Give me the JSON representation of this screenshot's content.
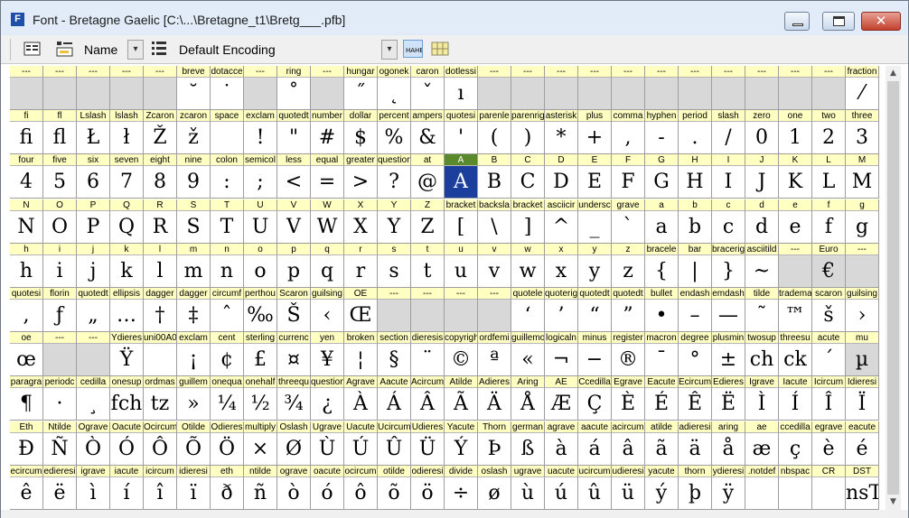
{
  "window": {
    "title": "Font - Bretagne Gaelic [C:\\...\\Bretagne_t1\\Bretg___.pfb]",
    "app_icon": "F"
  },
  "toolbar": {
    "name_label": "Name",
    "encoding_label": "Default Encoding"
  },
  "rows": [
    [
      [
        "---",
        ""
      ],
      [
        "---",
        ""
      ],
      [
        "---",
        ""
      ],
      [
        "---",
        ""
      ],
      [
        "---",
        ""
      ],
      [
        "breve",
        "˘"
      ],
      [
        "dotacce",
        "˙"
      ],
      [
        "---",
        ""
      ],
      [
        "ring",
        "˚"
      ],
      [
        "---",
        ""
      ],
      [
        "hungar",
        "˝"
      ],
      [
        "ogonek",
        "˛"
      ],
      [
        "caron",
        "ˇ"
      ],
      [
        "dotlessi",
        "ı"
      ],
      [
        "---",
        ""
      ],
      [
        "---",
        ""
      ],
      [
        "---",
        ""
      ],
      [
        "---",
        ""
      ],
      [
        "---",
        ""
      ],
      [
        "---",
        ""
      ],
      [
        "---",
        ""
      ],
      [
        "---",
        ""
      ],
      [
        "---",
        ""
      ],
      [
        "---",
        ""
      ],
      [
        "---",
        ""
      ],
      [
        "fraction",
        "⁄"
      ]
    ],
    [
      [
        "fi",
        "ﬁ"
      ],
      [
        "fl",
        "ﬂ"
      ],
      [
        "Lslash",
        "Ł"
      ],
      [
        "lslash",
        "ł"
      ],
      [
        "Zcaron",
        "Ž"
      ],
      [
        "zcaron",
        "ž"
      ],
      [
        "space",
        ""
      ],
      [
        "exclam",
        "!"
      ],
      [
        "quotedt",
        "\""
      ],
      [
        "number",
        "#"
      ],
      [
        "dollar",
        "$"
      ],
      [
        "percent",
        "%"
      ],
      [
        "ampers",
        "&"
      ],
      [
        "quotesi",
        "'"
      ],
      [
        "parenle",
        "("
      ],
      [
        "parenrig",
        ")"
      ],
      [
        "asterisk",
        "*"
      ],
      [
        "plus",
        "+"
      ],
      [
        "comma",
        ","
      ],
      [
        "hyphen",
        "-"
      ],
      [
        "period",
        "."
      ],
      [
        "slash",
        "/"
      ],
      [
        "zero",
        "0"
      ],
      [
        "one",
        "1"
      ],
      [
        "two",
        "2"
      ],
      [
        "three",
        "3"
      ]
    ],
    [
      [
        "four",
        "4"
      ],
      [
        "five",
        "5"
      ],
      [
        "six",
        "6"
      ],
      [
        "seven",
        "7"
      ],
      [
        "eight",
        "8"
      ],
      [
        "nine",
        "9"
      ],
      [
        "colon",
        ":"
      ],
      [
        "semicol",
        ";"
      ],
      [
        "less",
        "<"
      ],
      [
        "equal",
        "="
      ],
      [
        "greater",
        ">"
      ],
      [
        "question",
        "?"
      ],
      [
        "at",
        "@"
      ],
      [
        "A",
        "A"
      ],
      [
        "B",
        "B"
      ],
      [
        "C",
        "C"
      ],
      [
        "D",
        "D"
      ],
      [
        "E",
        "E"
      ],
      [
        "F",
        "F"
      ],
      [
        "G",
        "G"
      ],
      [
        "H",
        "H"
      ],
      [
        "I",
        "I"
      ],
      [
        "J",
        "J"
      ],
      [
        "K",
        "K"
      ],
      [
        "L",
        "L"
      ],
      [
        "M",
        "M"
      ]
    ],
    [
      [
        "N",
        "N"
      ],
      [
        "O",
        "O"
      ],
      [
        "P",
        "P"
      ],
      [
        "Q",
        "Q"
      ],
      [
        "R",
        "R"
      ],
      [
        "S",
        "S"
      ],
      [
        "T",
        "T"
      ],
      [
        "U",
        "U"
      ],
      [
        "V",
        "V"
      ],
      [
        "W",
        "W"
      ],
      [
        "X",
        "X"
      ],
      [
        "Y",
        "Y"
      ],
      [
        "Z",
        "Z"
      ],
      [
        "bracket",
        "["
      ],
      [
        "backsla",
        "\\"
      ],
      [
        "bracket",
        "]"
      ],
      [
        "asciicir",
        "^"
      ],
      [
        "undersc",
        "_"
      ],
      [
        "grave",
        "`"
      ],
      [
        "a",
        "a"
      ],
      [
        "b",
        "b"
      ],
      [
        "c",
        "c"
      ],
      [
        "d",
        "d"
      ],
      [
        "e",
        "e"
      ],
      [
        "f",
        "f"
      ],
      [
        "g",
        "g"
      ]
    ],
    [
      [
        "h",
        "h"
      ],
      [
        "i",
        "i"
      ],
      [
        "j",
        "j"
      ],
      [
        "k",
        "k"
      ],
      [
        "l",
        "l"
      ],
      [
        "m",
        "m"
      ],
      [
        "n",
        "n"
      ],
      [
        "o",
        "o"
      ],
      [
        "p",
        "p"
      ],
      [
        "q",
        "q"
      ],
      [
        "r",
        "r"
      ],
      [
        "s",
        "s"
      ],
      [
        "t",
        "t"
      ],
      [
        "u",
        "u"
      ],
      [
        "v",
        "v"
      ],
      [
        "w",
        "w"
      ],
      [
        "x",
        "x"
      ],
      [
        "y",
        "y"
      ],
      [
        "z",
        "z"
      ],
      [
        "bracele",
        "{"
      ],
      [
        "bar",
        "|"
      ],
      [
        "bracerig",
        "}"
      ],
      [
        "asciitild",
        "~"
      ],
      [
        "---",
        ""
      ],
      [
        "Euro",
        "€"
      ],
      [
        "---",
        ""
      ]
    ],
    [
      [
        "quotesi",
        ","
      ],
      [
        "florin",
        "ƒ"
      ],
      [
        "quotedt",
        "„"
      ],
      [
        "ellipsis",
        "…"
      ],
      [
        "dagger",
        "†"
      ],
      [
        "dagger",
        "‡"
      ],
      [
        "circumf",
        "ˆ"
      ],
      [
        "perthou",
        "‰"
      ],
      [
        "Scaron",
        "Š"
      ],
      [
        "guilsing",
        "‹"
      ],
      [
        "OE",
        "Œ"
      ],
      [
        "---",
        ""
      ],
      [
        "---",
        ""
      ],
      [
        "---",
        ""
      ],
      [
        "---",
        ""
      ],
      [
        "quotele",
        "‘"
      ],
      [
        "quoterig",
        "’"
      ],
      [
        "quotedt",
        "“"
      ],
      [
        "quotedt",
        "”"
      ],
      [
        "bullet",
        "•"
      ],
      [
        "endash",
        "–"
      ],
      [
        "emdash",
        "—"
      ],
      [
        "tilde",
        "˜"
      ],
      [
        "tradema",
        "™"
      ],
      [
        "scaron",
        "š"
      ],
      [
        "guilsing",
        "›"
      ]
    ],
    [
      [
        "oe",
        "œ"
      ],
      [
        "---",
        ""
      ],
      [
        "---",
        ""
      ],
      [
        "Ydieres",
        "Ÿ"
      ],
      [
        "uni00A0",
        ""
      ],
      [
        "exclam",
        "¡"
      ],
      [
        "cent",
        "¢"
      ],
      [
        "sterling",
        "£"
      ],
      [
        "currenc",
        "¤"
      ],
      [
        "yen",
        "¥"
      ],
      [
        "broken",
        "¦"
      ],
      [
        "section",
        "§"
      ],
      [
        "dieresis",
        "¨"
      ],
      [
        "copyrigh",
        "©"
      ],
      [
        "ordfemi",
        "ª"
      ],
      [
        "guillemo",
        "«"
      ],
      [
        "logicaln",
        "¬"
      ],
      [
        "minus",
        "−"
      ],
      [
        "register",
        "®"
      ],
      [
        "macron",
        "¯"
      ],
      [
        "degree",
        "°"
      ],
      [
        "plusmin",
        "±"
      ],
      [
        "twosup",
        "ch"
      ],
      [
        "threesu",
        "ck"
      ],
      [
        "acute",
        "´"
      ],
      [
        "mu",
        "µ"
      ]
    ],
    [
      [
        "paragra",
        "¶"
      ],
      [
        "periodc",
        "·"
      ],
      [
        "cedilla",
        "¸"
      ],
      [
        "onesup",
        "fch"
      ],
      [
        "ordmas",
        "tz"
      ],
      [
        "guillem",
        "»"
      ],
      [
        "onequa",
        "¼"
      ],
      [
        "onehalf",
        "½"
      ],
      [
        "threequ",
        "¾"
      ],
      [
        "question",
        "¿"
      ],
      [
        "Agrave",
        "À"
      ],
      [
        "Aacute",
        "Á"
      ],
      [
        "Acircum",
        "Â"
      ],
      [
        "Atilde",
        "Ã"
      ],
      [
        "Adieres",
        "Ä"
      ],
      [
        "Aring",
        "Å"
      ],
      [
        "AE",
        "Æ"
      ],
      [
        "Ccedilla",
        "Ç"
      ],
      [
        "Egrave",
        "È"
      ],
      [
        "Eacute",
        "É"
      ],
      [
        "Ecircum",
        "Ê"
      ],
      [
        "Edieres",
        "Ë"
      ],
      [
        "Igrave",
        "Ì"
      ],
      [
        "Iacute",
        "Í"
      ],
      [
        "Icircum",
        "Î"
      ],
      [
        "Idieresi",
        "Ï"
      ]
    ],
    [
      [
        "Eth",
        "Ð"
      ],
      [
        "Ntilde",
        "Ñ"
      ],
      [
        "Ograve",
        "Ò"
      ],
      [
        "Oacute",
        "Ó"
      ],
      [
        "Ocircum",
        "Ô"
      ],
      [
        "Otilde",
        "Õ"
      ],
      [
        "Odieres",
        "Ö"
      ],
      [
        "multiply",
        "×"
      ],
      [
        "Oslash",
        "Ø"
      ],
      [
        "Ugrave",
        "Ù"
      ],
      [
        "Uacute",
        "Ú"
      ],
      [
        "Ucircum",
        "Û"
      ],
      [
        "Udieres",
        "Ü"
      ],
      [
        "Yacute",
        "Ý"
      ],
      [
        "Thorn",
        "Þ"
      ],
      [
        "german",
        "ß"
      ],
      [
        "agrave",
        "à"
      ],
      [
        "aacute",
        "á"
      ],
      [
        "acircum",
        "â"
      ],
      [
        "atilde",
        "ã"
      ],
      [
        "adieresi",
        "ä"
      ],
      [
        "aring",
        "å"
      ],
      [
        "ae",
        "æ"
      ],
      [
        "ccedilla",
        "ç"
      ],
      [
        "egrave",
        "è"
      ],
      [
        "eacute",
        "é"
      ]
    ],
    [
      [
        "ecircum",
        "ê"
      ],
      [
        "edieresi",
        "ë"
      ],
      [
        "igrave",
        "ì"
      ],
      [
        "iacute",
        "í"
      ],
      [
        "icircum",
        "î"
      ],
      [
        "idieresi",
        "ï"
      ],
      [
        "eth",
        "ð"
      ],
      [
        "ntilde",
        "ñ"
      ],
      [
        "ograve",
        "ò"
      ],
      [
        "oacute",
        "ó"
      ],
      [
        "ocircum",
        "ô"
      ],
      [
        "otilde",
        "õ"
      ],
      [
        "odieresi",
        "ö"
      ],
      [
        "divide",
        "÷"
      ],
      [
        "oslash",
        "ø"
      ],
      [
        "ugrave",
        "ù"
      ],
      [
        "uacute",
        "ú"
      ],
      [
        "ucircum",
        "û"
      ],
      [
        "udieresi",
        "ü"
      ],
      [
        "yacute",
        "ý"
      ],
      [
        "thorn",
        "þ"
      ],
      [
        "ydieresi",
        "ÿ"
      ],
      [
        ".notdef",
        ""
      ],
      [
        "nbspac",
        ""
      ],
      [
        "CR",
        ""
      ],
      [
        "DST",
        "nsT"
      ]
    ]
  ],
  "selected": {
    "row": 2,
    "col": 13
  },
  "empty_cells": [
    [
      0,
      0
    ],
    [
      0,
      1
    ],
    [
      0,
      2
    ],
    [
      0,
      3
    ],
    [
      0,
      4
    ],
    [
      0,
      7
    ],
    [
      0,
      9
    ],
    [
      0,
      14
    ],
    [
      0,
      15
    ],
    [
      0,
      16
    ],
    [
      0,
      17
    ],
    [
      0,
      18
    ],
    [
      0,
      19
    ],
    [
      0,
      20
    ],
    [
      0,
      21
    ],
    [
      0,
      22
    ],
    [
      0,
      23
    ],
    [
      0,
      24
    ],
    [
      4,
      23
    ],
    [
      4,
      24
    ],
    [
      4,
      25
    ],
    [
      5,
      11
    ],
    [
      5,
      12
    ],
    [
      5,
      13
    ],
    [
      5,
      14
    ],
    [
      6,
      1
    ],
    [
      6,
      2
    ],
    [
      6,
      25
    ]
  ]
}
